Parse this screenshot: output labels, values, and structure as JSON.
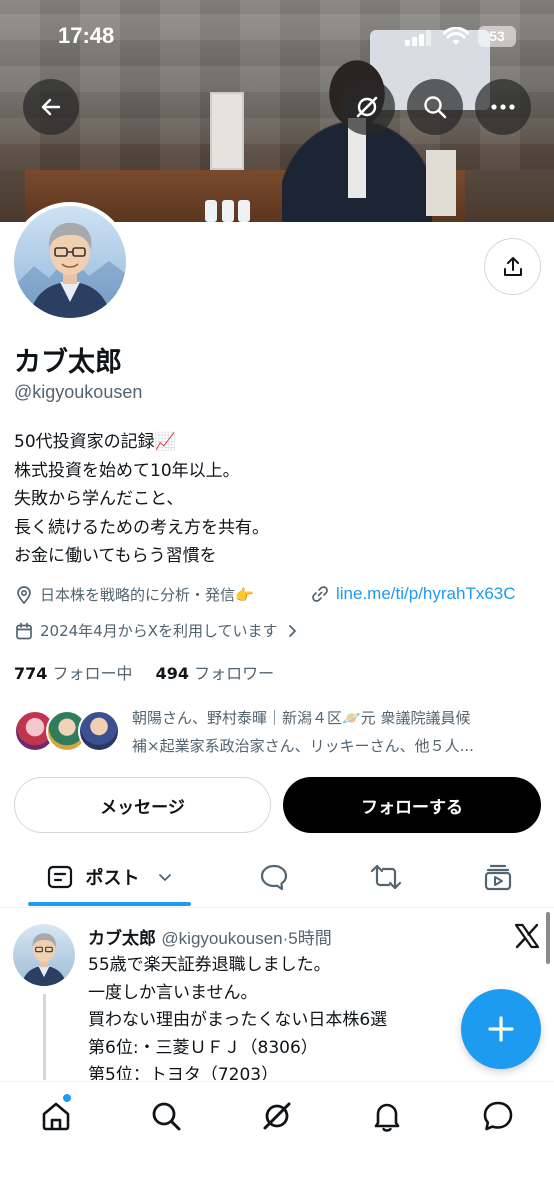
{
  "status_bar": {
    "time": "17:48",
    "battery": "53"
  },
  "profile": {
    "name": "カブ太郎",
    "handle": "@kigyoukousen",
    "bio": [
      "50代投資家の記録📈",
      "株式投資を始めて10年以上。",
      "失敗から学んだこと、",
      "長く続けるための考え方を共有。",
      "お金に働いてもらう習慣を"
    ],
    "location": "日本株を戦略的に分析・発信👉",
    "website": "line.me/ti/p/hyrahTx63C",
    "joined": "2024年4月からXを利用しています",
    "following_count": "774",
    "following_label": "フォロー中",
    "followers_count": "494",
    "followers_label": "フォロワー",
    "followed_by_line1": "朝陽さん、野村泰暉｜新潟４区🪐元 衆議院議員候",
    "followed_by_line2": "補×起業家系政治家さん、リッキーさん、他５人..."
  },
  "actions": {
    "message": "メッセージ",
    "follow": "フォローする"
  },
  "tabs": {
    "posts": "ポスト"
  },
  "tweet": {
    "name": "カブ太郎",
    "handle_time": "@kigyoukousen·5時間",
    "lines": [
      "55歳で楽天証券退職しました。",
      "一度しか言いません。",
      "買わない理由がまったくない日本株6選",
      "第6位:・三菱ＵＦＪ（8306）",
      "第5位：トヨタ（7203）"
    ]
  },
  "colors": {
    "accent": "#1d9bf0",
    "text": "#0f1419",
    "muted": "#536471"
  },
  "icons": [
    "back-arrow-icon",
    "grok-icon",
    "search-icon",
    "more-icon",
    "share-icon",
    "location-icon",
    "link-icon",
    "calendar-icon",
    "chevron-right-icon",
    "posts-icon",
    "chevron-down-icon",
    "reply-icon",
    "repost-icon",
    "media-icon",
    "x-logo-icon",
    "plus-icon",
    "home-icon",
    "bell-icon",
    "messages-icon"
  ]
}
